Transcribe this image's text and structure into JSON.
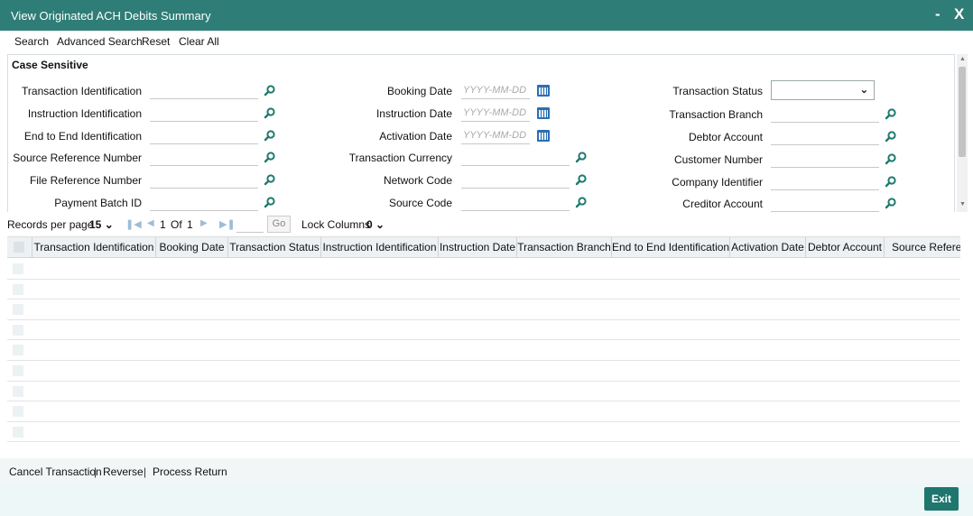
{
  "window": {
    "title": "View Originated ACH Debits Summary",
    "minimize": "-",
    "close": "X"
  },
  "menu": [
    "Search",
    "Advanced Search",
    "Reset",
    "Clear All"
  ],
  "criteria": {
    "legend": "Case Sensitive",
    "date_placeholder": "YYYY-MM-DD",
    "col1": [
      "Transaction Identification",
      "Instruction Identification",
      "End to End Identification",
      "Source Reference Number",
      "File Reference Number",
      "Payment Batch ID"
    ],
    "col2": [
      "Booking Date",
      "Instruction Date",
      "Activation Date",
      "Transaction Currency",
      "Network Code",
      "Source Code"
    ],
    "col3": [
      "Transaction Status",
      "Transaction Branch",
      "Debtor Account",
      "Customer Number",
      "Company Identifier",
      "Creditor Account"
    ],
    "transaction_status_value": ""
  },
  "pager": {
    "records_label": "Records per page",
    "records_value": "15",
    "page_current": "1",
    "page_of": "Of",
    "page_total": "1",
    "go_label": "Go",
    "lock_label": "Lock Columns",
    "lock_value": "0"
  },
  "grid": {
    "columns": [
      "Transaction Identification",
      "Booking Date",
      "Transaction Status",
      "Instruction Identification",
      "Instruction Date",
      "Transaction Branch",
      "End to End Identification",
      "Activation Date",
      "Debtor Account",
      "Source Referenc"
    ],
    "row_count": 9
  },
  "footer": {
    "cancel": "Cancel Transaction",
    "reverse": "Reverse",
    "process_return": "Process Return",
    "separator": "|"
  },
  "exit_label": "Exit",
  "colors": {
    "header": "#2e7d76",
    "exit": "#1e766f",
    "search_icon": "#1e7a6f",
    "calendar": "#2b6fb3"
  }
}
